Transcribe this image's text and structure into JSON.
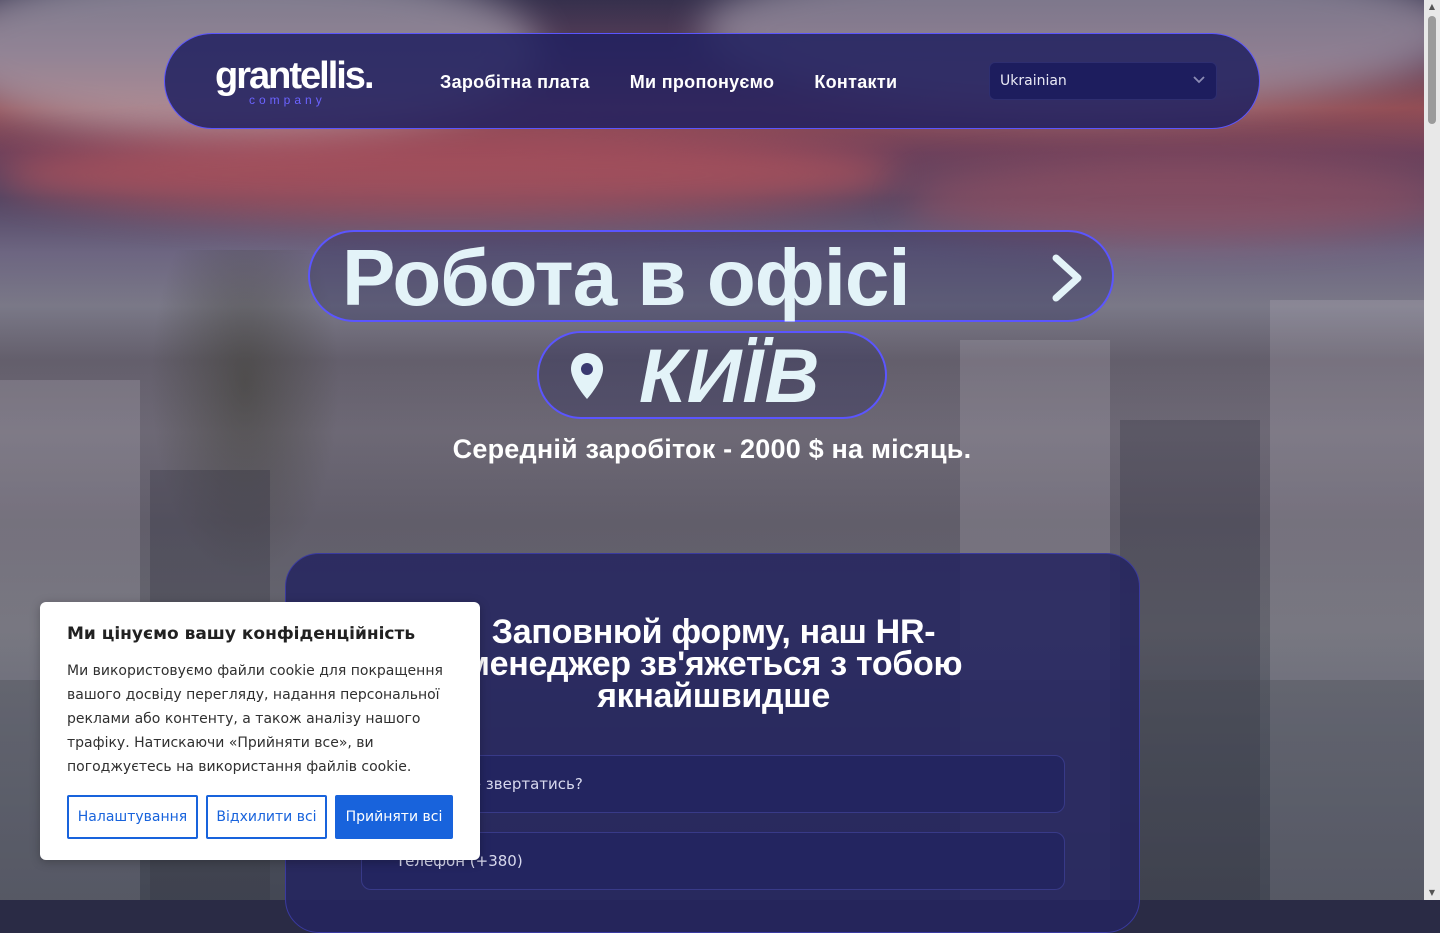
{
  "header": {
    "logo": {
      "word": "grantellis",
      "dot": ".",
      "sub": "company"
    },
    "nav": [
      "Заробітна плата",
      "Ми пропонуємо",
      "Контакти"
    ],
    "language": {
      "selected": "Ukrainian"
    }
  },
  "hero": {
    "title": "Робота в офісі",
    "city": "КИЇВ",
    "salary": "Середній заробіток - 2000 $ на місяць."
  },
  "form": {
    "title_line1": "Заповнюй форму, наш HR-",
    "title_line2": "менеджер зв'яжеться з тобою",
    "title_line3": "якнайшвидше",
    "field1_placeholder": "Як до тебе звертатись?",
    "field2_placeholder": "Телефон (+380)"
  },
  "cookie": {
    "title": "Ми цінуємо вашу конфіденційність",
    "text": "Ми використовуємо файли cookie для покращення вашого досвіду перегляду, надання персональної реклами або контенту, а також аналізу нашого трафіку. Натискаючи «Прийняти все», ви погоджуєтесь на використання файлів cookie.",
    "btn_settings": "Налаштування",
    "btn_reject": "Відхилити всі",
    "btn_accept": "Прийняти всі"
  },
  "colors": {
    "accent": "#5b55ff",
    "header_bg": "#212160",
    "cookie_primary": "#1863dc"
  },
  "icons": [
    "chevron-down-icon",
    "chevron-right-icon",
    "map-pin-icon"
  ]
}
